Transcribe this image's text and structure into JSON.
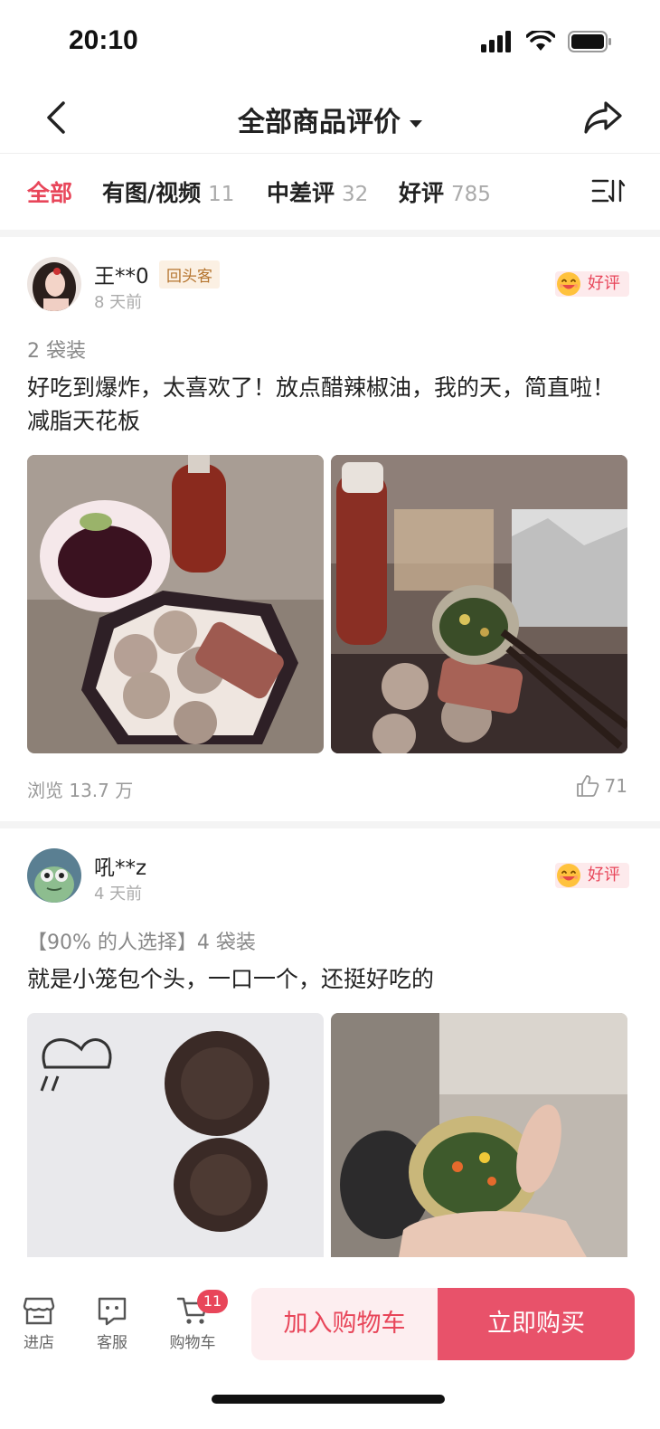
{
  "status_bar": {
    "time": "20:10"
  },
  "nav": {
    "title": "全部商品评价"
  },
  "filters": {
    "tabs": [
      {
        "label": "全部",
        "count": ""
      },
      {
        "label": "有图/视频",
        "count": "11"
      },
      {
        "label": "中差评",
        "count": "32"
      },
      {
        "label": "好评",
        "count": "785"
      }
    ]
  },
  "reviews": [
    {
      "user": "王**0",
      "repeat_badge": "回头客",
      "time": "8 天前",
      "rating": "好评",
      "variant": "2 袋装",
      "text": "好吃到爆炸，太喜欢了！放点醋辣椒油，我的天，简直啦！减脂天花板",
      "views": "浏览 13.7 万",
      "likes": "71"
    },
    {
      "user": "吼**z",
      "time": "4 天前",
      "rating": "好评",
      "variant": "【90% 的人选择】4 袋装",
      "text": "就是小笼包个头，一口一个，还挺好吃的"
    }
  ],
  "bottom_bar": {
    "store": "进店",
    "service": "客服",
    "cart": "购物车",
    "cart_count": "11",
    "add_to_cart": "加入购物车",
    "buy_now": "立即购买"
  },
  "colors": {
    "accent": "#e8465a",
    "buy_button": "#e8526a",
    "badge_bg": "#fdeaec"
  }
}
